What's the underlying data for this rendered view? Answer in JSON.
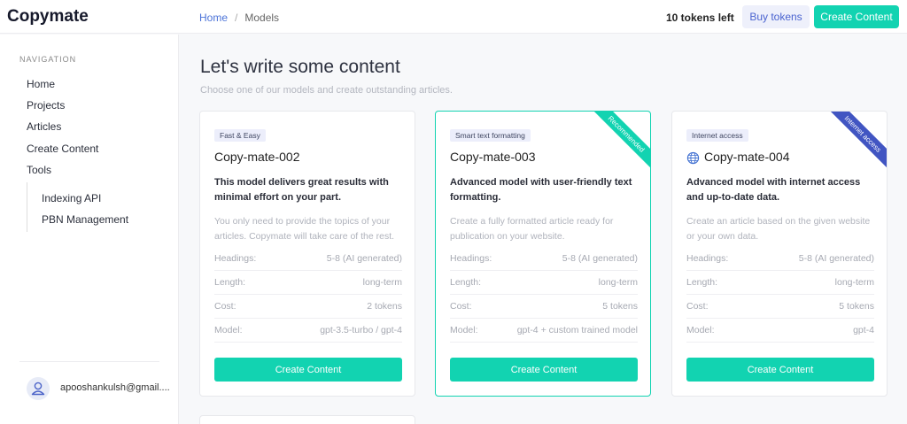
{
  "brand": "Copymate",
  "breadcrumb": {
    "home": "Home",
    "separator": "/",
    "current": "Models"
  },
  "header": {
    "tokens_left": "10 tokens left",
    "buy_label": "Buy tokens",
    "create_label": "Create Content"
  },
  "sidebar": {
    "nav_title": "NAVIGATION",
    "items": [
      "Home",
      "Projects",
      "Articles",
      "Create Content",
      "Tools"
    ],
    "tools_items": [
      "Indexing API",
      "PBN Management"
    ],
    "user_email": "apooshankulsh@gmail...."
  },
  "main": {
    "title": "Let's write some content",
    "subtitle": "Choose one of our models and create outstanding articles."
  },
  "spec_labels": {
    "headings": "Headings:",
    "length": "Length:",
    "cost": "Cost:",
    "model": "Model:"
  },
  "cards": [
    {
      "badge": "Fast & Easy",
      "title": "Copy-mate-002",
      "headline": "This model delivers great results with minimal effort on your part.",
      "description": "You only need to provide the topics of your articles. Copymate will take care of the rest.",
      "headings": "5-8 (AI generated)",
      "length": "long-term",
      "cost": "2 tokens",
      "model": "gpt-3.5-turbo / gpt-4",
      "button": "Create Content"
    },
    {
      "badge": "Smart text formatting",
      "title": "Copy-mate-003",
      "headline": "Advanced model with user-friendly text formatting.",
      "description": "Create a fully formatted article ready for publication on your website.",
      "headings": "5-8 (AI generated)",
      "length": "long-term",
      "cost": "5 tokens",
      "model": "gpt-4 + custom trained model",
      "button": "Create Content",
      "ribbon": "Recommended",
      "ribbon_color": "#12d3b1"
    },
    {
      "badge": "Internet access",
      "title": "Copy-mate-004",
      "title_icon": "globe-icon",
      "headline": "Advanced model with internet access and up-to-date data.",
      "description": "Create an article based on the given website or your own data.",
      "headings": "5-8 (AI generated)",
      "length": "long-term",
      "cost": "5 tokens",
      "model": "gpt-4",
      "button": "Create Content",
      "ribbon": "Internet access",
      "ribbon_color": "#4155c2"
    }
  ],
  "colors": {
    "accent": "#12d3b1",
    "link": "#4b73d8",
    "ribbon_blue": "#4155c2"
  }
}
